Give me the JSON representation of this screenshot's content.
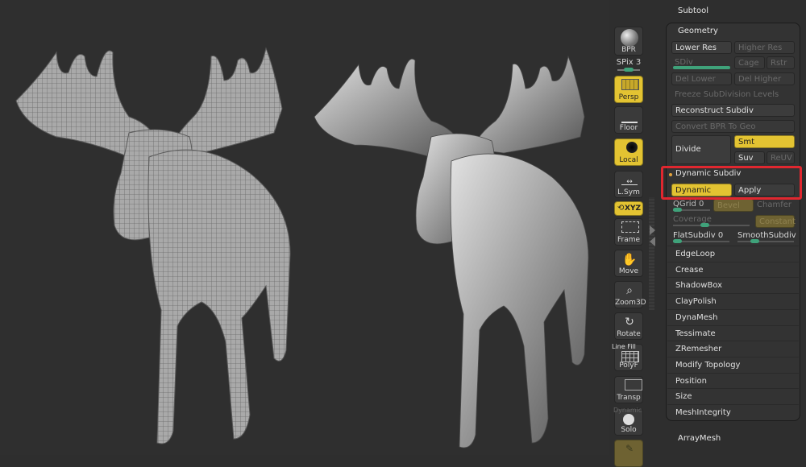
{
  "viewport": {
    "left_model": {
      "name": "moose-wireframe-polyframe",
      "shading": "polyframe"
    },
    "right_model": {
      "name": "moose-smooth-dynamic-subdiv",
      "shading": "smooth"
    }
  },
  "shelf": {
    "buttons": [
      {
        "id": "bpr",
        "label": "BPR",
        "active": false,
        "icon": "sphere-icon"
      },
      {
        "id": "spix",
        "label": "SPix 3",
        "active": false,
        "icon": "slider-icon",
        "value": 3
      },
      {
        "id": "persp",
        "label": "Persp",
        "active": true,
        "icon": "perspective-grid-icon"
      },
      {
        "id": "floor",
        "label": "Floor",
        "active": false,
        "icon": "floor-icon"
      },
      {
        "id": "local",
        "label": "Local",
        "active": true,
        "icon": "local-pivot-icon"
      },
      {
        "id": "lsym",
        "label": "L.Sym",
        "active": false,
        "icon": "symmetry-icon"
      },
      {
        "id": "xyz",
        "label": "XYZ",
        "active": true,
        "icon": "xyz-rotate-icon"
      },
      {
        "id": "frame",
        "label": "Frame",
        "active": false,
        "icon": "frame-icon"
      },
      {
        "id": "move",
        "label": "Move",
        "active": false,
        "icon": "hand-move-icon"
      },
      {
        "id": "zoom3d",
        "label": "Zoom3D",
        "active": false,
        "icon": "zoom-icon"
      },
      {
        "id": "rotate",
        "label": "Rotate",
        "active": false,
        "icon": "rotate-icon"
      },
      {
        "id": "polyf",
        "label": "PolyF",
        "sublabel": "Line Fill",
        "active": false,
        "icon": "polyframe-icon"
      },
      {
        "id": "transp",
        "label": "Transp",
        "active": false,
        "icon": "transparency-icon"
      },
      {
        "id": "solo",
        "label": "Solo",
        "sublabel": "Dynamic",
        "active": false,
        "icon": "solo-icon"
      }
    ]
  },
  "panel": {
    "header_above": "Subtool",
    "section": "Geometry",
    "lower_res": "Lower Res",
    "higher_res": "Higher Res",
    "sdiv": "SDiv",
    "cage": "Cage",
    "rstr": "Rstr",
    "del_lower": "Del Lower",
    "del_higher": "Del Higher",
    "freeze": "Freeze SubDivision Levels",
    "reconstruct": "Reconstruct Subdiv",
    "convert_bpr": "Convert BPR To Geo",
    "divide": "Divide",
    "smt": "Smt",
    "suv": "Suv",
    "reuv": "ReUV",
    "dynamic_subdiv": {
      "title": "Dynamic Subdiv",
      "dynamic": "Dynamic",
      "apply": "Apply",
      "qgrid": "QGrid 0",
      "bevel": "Bevel",
      "chamfer": "Chamfer",
      "coverage": "Coverage",
      "constant": "Constant",
      "flatsubdiv": "FlatSubdiv 0",
      "smoothsubdiv": "SmoothSubdiv"
    },
    "subpalettes": [
      "EdgeLoop",
      "Crease",
      "ShadowBox",
      "ClayPolish",
      "DynaMesh",
      "Tessimate",
      "ZRemesher",
      "Modify Topology",
      "Position",
      "Size",
      "MeshIntegrity"
    ],
    "next_header": "ArrayMesh"
  },
  "colors": {
    "accent": "#e3c332",
    "highlight": "#e0272f",
    "slider": "#3fa27a"
  }
}
